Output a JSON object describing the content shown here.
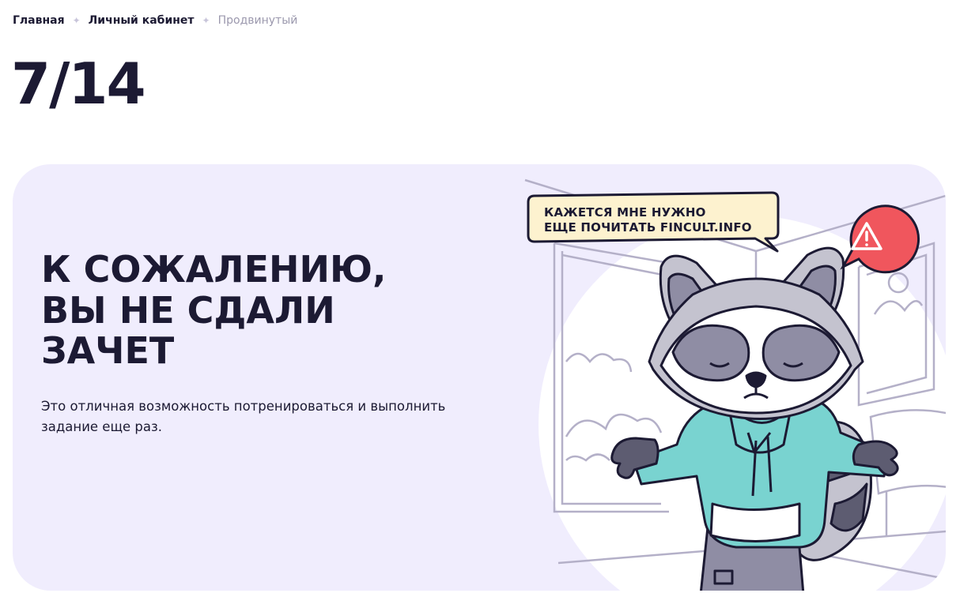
{
  "breadcrumb": {
    "items": [
      "Главная",
      "Личный кабинет",
      "Продвинутый"
    ]
  },
  "progress": {
    "label": "7/14",
    "current": 7,
    "total": 14
  },
  "result": {
    "title_lines": [
      "К СОЖАЛЕНИЮ,",
      "ВЫ НЕ СДАЛИ",
      "ЗАЧЕТ"
    ],
    "text": "Это отличная возможность потренироваться и выполнить задание еще раз."
  },
  "illustration": {
    "speech_lines": [
      "КАЖЕТСЯ МНЕ НУЖНО",
      "ЕЩЕ ПОЧИТАТЬ FINCULT.INFO"
    ],
    "icons": [
      "raccoon-illustration",
      "warning-icon"
    ]
  },
  "colors": {
    "card_background": "#f0edfd",
    "text_dark": "#1c1a33",
    "breadcrumb_muted": "#9b98ad",
    "speech_bubble": "#fdf2cf",
    "warning": "#f0565d",
    "hoodie": "#79d3d0",
    "fur_grey": "#c4c3cf"
  }
}
